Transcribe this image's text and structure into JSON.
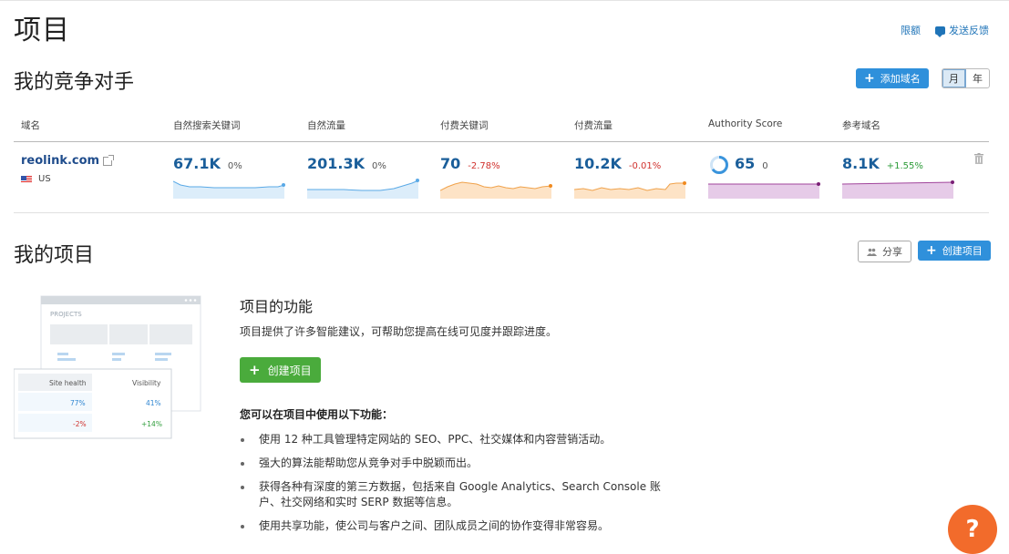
{
  "page": {
    "title": "项目"
  },
  "top_links": {
    "limits": "限额",
    "feedback": "发送反馈"
  },
  "competitors": {
    "title": "我的竞争对手",
    "add_domain": "添加域名",
    "period_month": "月",
    "period_year": "年",
    "columns": [
      "域名",
      "自然搜索关键词",
      "自然流量",
      "付费关键词",
      "付费流量",
      "Authority Score",
      "参考域名"
    ],
    "row": {
      "domain": "reolink.com",
      "country": "US",
      "organic_keywords": {
        "value": "67.1K",
        "change": "0%"
      },
      "organic_traffic": {
        "value": "201.3K",
        "change": "0%"
      },
      "paid_keywords": {
        "value": "70",
        "change": "-2.78%"
      },
      "paid_traffic": {
        "value": "10.2K",
        "change": "-0.01%"
      },
      "authority_score": {
        "value": "65",
        "change": "0",
        "fraction": 0.65
      },
      "referring_domains": {
        "value": "8.1K",
        "change": "+1.55%"
      }
    },
    "colors": {
      "blue": "#5aa9e6",
      "orange": "#f0a24b",
      "purple": "#a0449b"
    }
  },
  "projects": {
    "title": "我的项目",
    "share": "分享",
    "create": "创建项目",
    "illustration": {
      "header": "PROJECTS",
      "col1": "Site health",
      "col2": "Visibility",
      "r1c1": "77%",
      "r1c2": "41%",
      "r2c1": "-2%",
      "r2c2": "+14%"
    },
    "feature_title": "项目的功能",
    "feature_desc": "项目提供了许多智能建议，可帮助您提高在线可见度并跟踪进度。",
    "create_button": "创建项目",
    "use_title": "您可以在项目中使用以下功能：",
    "features": [
      "使用 12 种工具管理特定网站的 SEO、PPC、社交媒体和内容营销活动。",
      "强大的算法能帮助您从竞争对手中脱颖而出。",
      "获得各种有深度的第三方数据，包括来自 Google Analytics、Search Console 账户、社交网络和实时 SERP 数据等信息。",
      "使用共享功能，使公司与客户之间、团队成员之间的协作变得非常容易。"
    ]
  },
  "help": {
    "label": "?"
  }
}
